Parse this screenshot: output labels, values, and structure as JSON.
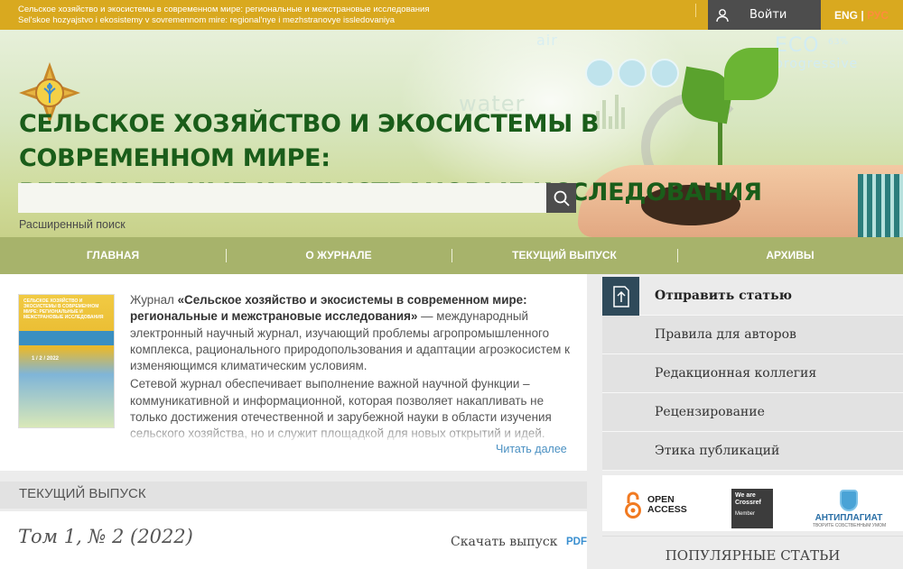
{
  "topbar": {
    "title_ru": "Сельское хозяйство и экосистемы в современном мире: региональные и межстрановые исследования",
    "title_translit": "Sel'skoe hozyajstvo i ekosistemy v sovremennom mire: regional'nye i mezhstranovye issledovaniya",
    "login_label": "Войти",
    "lang_en": "ENG",
    "lang_sep": "|",
    "lang_ru": "РУС"
  },
  "hero": {
    "word_air": "air",
    "word_water": "water",
    "word_eco": "ECO",
    "word_eco_pct": "63%",
    "word_progressive": "progressive",
    "title_line1": "СЕЛЬСКОЕ ХОЗЯЙСТВО И ЭКОСИСТЕМЫ В СОВРЕМЕННОМ МИРЕ:",
    "title_line2": "РЕГИОНАЛЬНЫЕ И МЕЖСТРАНОВЫЕ ИССЛЕДОВАНИЯ"
  },
  "search": {
    "placeholder": "",
    "advanced_label": "Расширенный поиск"
  },
  "nav": {
    "items": [
      {
        "label": "ГЛАВНАЯ"
      },
      {
        "label": "О ЖУРНАЛЕ"
      },
      {
        "label": "ТЕКУЩИЙ ВЫПУСК"
      },
      {
        "label": "АРХИВЫ"
      }
    ]
  },
  "intro": {
    "cover_title": "СЕЛЬСКОЕ ХОЗЯЙСТВО И ЭКОСИСТЕМЫ В СОВРЕМЕННОМ МИРЕ: РЕГИОНАЛЬНЫЕ И МЕЖСТРАНОВЫЕ ИССЛЕДОВАНИЯ",
    "cover_numbers": "1 / 2 / 2022",
    "p1_prefix": "Журнал ",
    "p1_bold": "«Сельское хозяйство и экосистемы в современном мире: региональные и межстрановые исследования»",
    "p1_rest": " — международный электронный научный журнал, изучающий проблемы агропромышленного комплекса, рационального природопользования и адаптации агроэкосистем к изменяющимся климатическим условиям.",
    "p2": "Сетевой журнал обеспечивает выполнение важной научной функции – коммуникативной и информационной, которая позволяет накапливать не только достижения отечественной и зарубежной науки в области изучения сельского хозяйства, но и служит площадкой для новых открытий и идей.",
    "read_more": "Читать далее"
  },
  "sidebar": {
    "items": [
      {
        "label": "Отправить статью"
      },
      {
        "label": "Правила для авторов"
      },
      {
        "label": "Редакционная коллегия"
      },
      {
        "label": "Рецензирование"
      },
      {
        "label": "Этика публикаций"
      }
    ]
  },
  "badges": {
    "oa_line1": "OPEN",
    "oa_line2": "ACCESS",
    "crossref_line1": "We are",
    "crossref_line2": "Crossref",
    "crossref_member": "Member",
    "anti_name": "АНТИПЛАГИАТ",
    "anti_sub": "ТВОРИТЕ СОБСТВЕННЫМ УМОМ"
  },
  "popular": {
    "title": "ПОПУЛЯРНЫЕ СТАТЬИ"
  },
  "current": {
    "header": "ТЕКУЩИЙ ВЫПУСК",
    "issue": "Том 1, № 2 (2022)",
    "download": "Скачать выпуск",
    "pdf": "PDF"
  },
  "colors": {
    "topbar": "#d9a91f",
    "nav": "#a7b36b",
    "title_green": "#1a5d1a",
    "dark_button": "#4d4d4d",
    "link_blue": "#4a90c2"
  }
}
